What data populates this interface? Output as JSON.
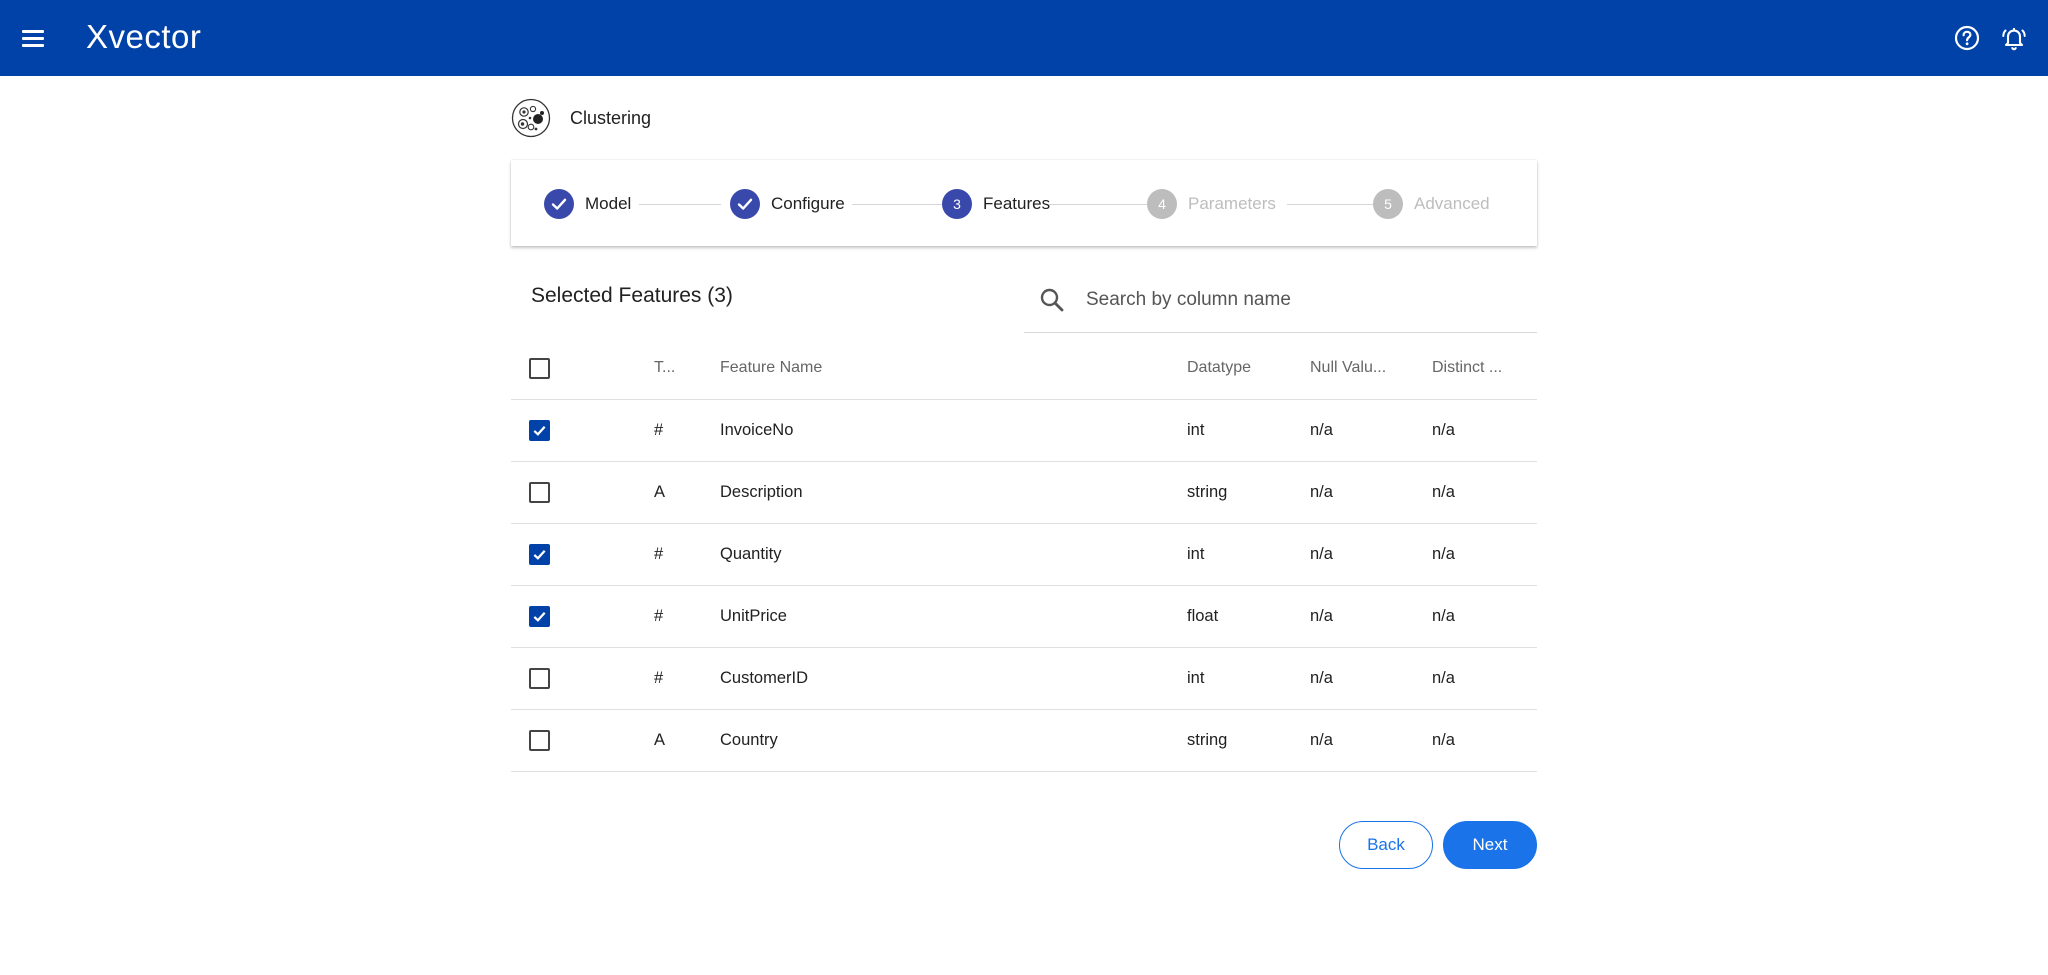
{
  "app": {
    "logo_text": "Xvector",
    "brand_color": "#0042a8",
    "icons": [
      "menu-icon",
      "help-icon",
      "notification-bell-icon"
    ]
  },
  "page": {
    "title": "Clustering"
  },
  "stepper": {
    "steps": [
      {
        "label": "Model",
        "status": "done",
        "number": "1"
      },
      {
        "label": "Configure",
        "status": "done",
        "number": "2"
      },
      {
        "label": "Features",
        "status": "active",
        "number": "3"
      },
      {
        "label": "Parameters",
        "status": "pending",
        "number": "4"
      },
      {
        "label": "Advanced",
        "status": "pending",
        "number": "5"
      }
    ]
  },
  "features": {
    "title": "Selected Features (3)",
    "search_placeholder": "Search by column name",
    "columns": {
      "type": "T...",
      "name": "Feature Name",
      "datatype": "Datatype",
      "null_values": "Null Valu...",
      "distinct": "Distinct ..."
    },
    "rows": [
      {
        "checked": true,
        "type": "#",
        "name": "InvoiceNo",
        "datatype": "int",
        "null_values": "n/a",
        "distinct": "n/a"
      },
      {
        "checked": false,
        "type": "A",
        "name": "Description",
        "datatype": "string",
        "null_values": "n/a",
        "distinct": "n/a"
      },
      {
        "checked": true,
        "type": "#",
        "name": "Quantity",
        "datatype": "int",
        "null_values": "n/a",
        "distinct": "n/a"
      },
      {
        "checked": true,
        "type": "#",
        "name": "UnitPrice",
        "datatype": "float",
        "null_values": "n/a",
        "distinct": "n/a"
      },
      {
        "checked": false,
        "type": "#",
        "name": "CustomerID",
        "datatype": "int",
        "null_values": "n/a",
        "distinct": "n/a"
      },
      {
        "checked": false,
        "type": "A",
        "name": "Country",
        "datatype": "string",
        "null_values": "n/a",
        "distinct": "n/a"
      }
    ]
  },
  "actions": {
    "back_label": "Back",
    "next_label": "Next",
    "primary_color": "#1a73e8"
  }
}
